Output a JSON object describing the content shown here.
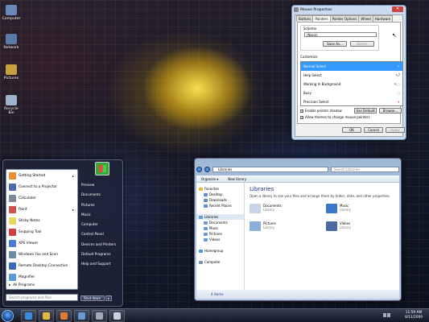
{
  "desktop": {
    "icons": [
      {
        "label": "Computer",
        "color": "#6a88b8"
      },
      {
        "label": "Network",
        "color": "#5a7aa8"
      },
      {
        "label": "Pictures",
        "color": "#c8a040"
      },
      {
        "label": "Recycle Bin",
        "color": "#9fb3c9"
      }
    ]
  },
  "mouse_dialog": {
    "title": "Mouse Properties",
    "close_label": "✕",
    "tabs": [
      "Buttons",
      "Pointers",
      "Pointer Options",
      "Wheel",
      "Hardware"
    ],
    "active_tab": "Pointers",
    "scheme_label": "Scheme",
    "scheme_value": "(None)",
    "save_as": "Save As...",
    "delete": "Delete",
    "customize_label": "Customize:",
    "cursors": [
      {
        "name": "Normal Select",
        "icon": "↖"
      },
      {
        "name": "Help Select",
        "icon": "↖?"
      },
      {
        "name": "Working In Background",
        "icon": "↖◌"
      },
      {
        "name": "Busy",
        "icon": "◌"
      },
      {
        "name": "Precision Select",
        "icon": "+"
      }
    ],
    "enable_shadow": "Enable pointer shadow",
    "use_default": "Use Default",
    "browse": "Browse...",
    "allow_themes": "Allow themes to change mouse pointers",
    "ok": "OK",
    "cancel": "Cancel",
    "apply": "Apply"
  },
  "explorer": {
    "address": "Libraries",
    "search_placeholder": "Search Libraries",
    "organize": "Organize ▾",
    "new_library": "New library",
    "nav": [
      {
        "label": "Favorites",
        "color": "#e8b830",
        "indent": false
      },
      {
        "label": "Desktop",
        "color": "#5a8ad0",
        "indent": true
      },
      {
        "label": "Downloads",
        "color": "#5a8ad0",
        "indent": true
      },
      {
        "label": "Recent Places",
        "color": "#5a8ad0",
        "indent": true
      },
      {
        "label": "",
        "color": "",
        "indent": false
      },
      {
        "label": "Libraries",
        "color": "#6a98d0",
        "indent": false
      },
      {
        "label": "Documents",
        "color": "#6a98d0",
        "indent": true
      },
      {
        "label": "Music",
        "color": "#6a98d0",
        "indent": true
      },
      {
        "label": "Pictures",
        "color": "#6a98d0",
        "indent": true
      },
      {
        "label": "Videos",
        "color": "#6a98d0",
        "indent": true
      },
      {
        "label": "",
        "color": "",
        "indent": false
      },
      {
        "label": "Homegroup",
        "color": "#3aa0d8",
        "indent": false
      },
      {
        "label": "",
        "color": "",
        "indent": false
      },
      {
        "label": "Computer",
        "color": "#7890b0",
        "indent": false
      }
    ],
    "heading": "Libraries",
    "description": "Open a library to see your files and arrange them by folder, date, and other properties.",
    "libraries": [
      {
        "name": "Documents",
        "sub": "Library",
        "color": "#c9d4e4"
      },
      {
        "name": "Music",
        "sub": "Library",
        "color": "#3a78c8"
      },
      {
        "name": "Pictures",
        "sub": "Library",
        "color": "#8ab0d8"
      },
      {
        "name": "Videos",
        "sub": "Library",
        "color": "#4a6aa0"
      }
    ],
    "status": "4 items"
  },
  "start_menu": {
    "items": [
      {
        "label": "Getting Started",
        "color": "#e89030",
        "arrow": "▸"
      },
      {
        "label": "Connect to a Projector",
        "color": "#4a6ab0",
        "arrow": ""
      },
      {
        "label": "Calculator",
        "color": "#7a8a9a",
        "arrow": ""
      },
      {
        "label": "Paint",
        "color": "#d05050",
        "arrow": "▸"
      },
      {
        "label": "Sticky Notes",
        "color": "#e8d860",
        "arrow": ""
      },
      {
        "label": "Snipping Tool",
        "color": "#d04040",
        "arrow": ""
      },
      {
        "label": "XPS Viewer",
        "color": "#4a7ad0",
        "arrow": ""
      },
      {
        "label": "Windows Fax and Scan",
        "color": "#6a8aa8",
        "arrow": ""
      },
      {
        "label": "Remote Desktop Connection",
        "color": "#3a6ab8",
        "arrow": ""
      },
      {
        "label": "Magnifier",
        "color": "#5a9ad8",
        "arrow": ""
      }
    ],
    "all_programs": "All Programs",
    "search_placeholder": "Search programs and files",
    "right_items": [
      "Preview",
      "Documents",
      "Pictures",
      "Music",
      "Computer",
      "Control Panel",
      "Devices and Printers",
      "Default Programs",
      "Help and Support"
    ],
    "shutdown": "Shut down",
    "shutdown_arrow": "▸"
  },
  "taskbar": {
    "buttons": [
      {
        "name": "ie-icon",
        "color": "#3a8ae0"
      },
      {
        "name": "folder-icon",
        "color": "#e0b840"
      },
      {
        "name": "media-player-icon",
        "color": "#e07a30"
      },
      {
        "name": "explorer-icon",
        "color": "#6a98d0"
      },
      {
        "name": "mouse-settings-icon",
        "color": "#a0a8b8"
      },
      {
        "name": "paint-icon",
        "color": "#c8d0e0"
      }
    ],
    "time": "11:59 AM",
    "date": "9/11/2009"
  }
}
